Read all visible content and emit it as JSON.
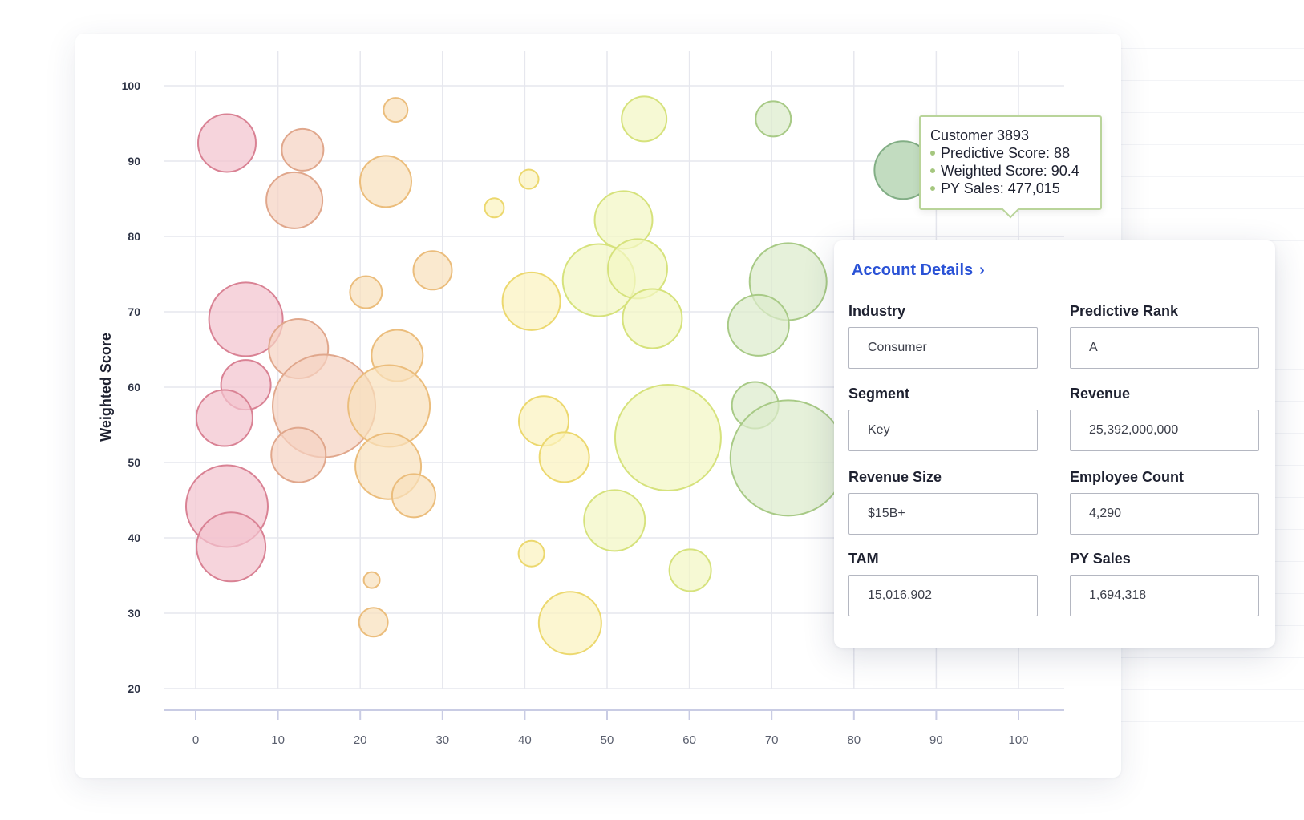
{
  "chart_data": {
    "type": "scatter",
    "ylabel": "Weighted Score",
    "xlabel": "",
    "xlim": [
      0,
      100
    ],
    "ylim": [
      20,
      100
    ],
    "x_ticks": [
      0,
      10,
      20,
      30,
      40,
      50,
      60,
      70,
      80,
      90,
      100
    ],
    "y_ticks": [
      20,
      30,
      40,
      50,
      60,
      70,
      80,
      90,
      100
    ],
    "grid": true,
    "points": [
      {
        "x": 3.8,
        "y": 92.4,
        "size": 36,
        "color": "red"
      },
      {
        "x": 6.1,
        "y": 69,
        "size": 46,
        "color": "red"
      },
      {
        "x": 6.1,
        "y": 60.3,
        "size": 31,
        "color": "red"
      },
      {
        "x": 3.5,
        "y": 55.9,
        "size": 35,
        "color": "red"
      },
      {
        "x": 3.8,
        "y": 44.2,
        "size": 51,
        "color": "red"
      },
      {
        "x": 4.3,
        "y": 38.8,
        "size": 43,
        "color": "red"
      },
      {
        "x": 13,
        "y": 91.5,
        "size": 26,
        "color": "salmon"
      },
      {
        "x": 12,
        "y": 84.8,
        "size": 35,
        "color": "salmon"
      },
      {
        "x": 12.5,
        "y": 65.1,
        "size": 37,
        "color": "salmon"
      },
      {
        "x": 15.6,
        "y": 57.5,
        "size": 64,
        "color": "salmon"
      },
      {
        "x": 12.5,
        "y": 51,
        "size": 34,
        "color": "salmon"
      },
      {
        "x": 24.3,
        "y": 96.8,
        "size": 15,
        "color": "orange"
      },
      {
        "x": 23.1,
        "y": 87.3,
        "size": 32,
        "color": "orange"
      },
      {
        "x": 28.8,
        "y": 75.5,
        "size": 24,
        "color": "orange"
      },
      {
        "x": 20.7,
        "y": 72.6,
        "size": 20,
        "color": "orange"
      },
      {
        "x": 24.5,
        "y": 64.2,
        "size": 32,
        "color": "orange"
      },
      {
        "x": 23.5,
        "y": 57.5,
        "size": 51,
        "color": "orange"
      },
      {
        "x": 23.4,
        "y": 49.5,
        "size": 41,
        "color": "orange"
      },
      {
        "x": 26.5,
        "y": 45.6,
        "size": 27,
        "color": "orange"
      },
      {
        "x": 21.4,
        "y": 34.4,
        "size": 10,
        "color": "orange"
      },
      {
        "x": 21.6,
        "y": 28.8,
        "size": 18,
        "color": "orange"
      },
      {
        "x": 36.3,
        "y": 83.8,
        "size": 12,
        "color": "yellow"
      },
      {
        "x": 40.5,
        "y": 87.6,
        "size": 12,
        "color": "yellow"
      },
      {
        "x": 40.8,
        "y": 71.4,
        "size": 36,
        "color": "yellow"
      },
      {
        "x": 42.3,
        "y": 55.5,
        "size": 31,
        "color": "yellow"
      },
      {
        "x": 44.8,
        "y": 50.7,
        "size": 31,
        "color": "yellow"
      },
      {
        "x": 40.8,
        "y": 37.9,
        "size": 16,
        "color": "yellow"
      },
      {
        "x": 45.5,
        "y": 28.7,
        "size": 39,
        "color": "yellow"
      },
      {
        "x": 54.5,
        "y": 95.6,
        "size": 28,
        "color": "lime"
      },
      {
        "x": 52,
        "y": 82.2,
        "size": 36,
        "color": "lime"
      },
      {
        "x": 49,
        "y": 74.2,
        "size": 45,
        "color": "lime"
      },
      {
        "x": 53.7,
        "y": 75.7,
        "size": 37,
        "color": "lime"
      },
      {
        "x": 55.5,
        "y": 69.1,
        "size": 37,
        "color": "lime"
      },
      {
        "x": 57.4,
        "y": 53.3,
        "size": 66,
        "color": "lime"
      },
      {
        "x": 50.9,
        "y": 42.3,
        "size": 38,
        "color": "lime"
      },
      {
        "x": 60.1,
        "y": 35.7,
        "size": 26,
        "color": "lime"
      },
      {
        "x": 70.2,
        "y": 95.6,
        "size": 22,
        "color": "green"
      },
      {
        "x": 72,
        "y": 74,
        "size": 48,
        "color": "green"
      },
      {
        "x": 68.4,
        "y": 68.2,
        "size": 38,
        "color": "green"
      },
      {
        "x": 68,
        "y": 57.6,
        "size": 29,
        "color": "green"
      },
      {
        "x": 72,
        "y": 50.6,
        "size": 72,
        "color": "green"
      },
      {
        "x": 86,
        "y": 88.8,
        "size": 36,
        "color": "darkgreen",
        "highlighted": true
      }
    ]
  },
  "tooltip": {
    "title": "Customer 3893",
    "predictive_score": "Predictive Score: 88",
    "weighted_score": "Weighted Score: 90.4",
    "py_sales": "PY Sales: 477,015"
  },
  "account_details": {
    "link_label": "Account Details",
    "fields": [
      {
        "label": "Industry",
        "value": "Consumer"
      },
      {
        "label": "Predictive Rank",
        "value": "A"
      },
      {
        "label": "Segment",
        "value": "Key"
      },
      {
        "label": "Revenue",
        "value": "25,392,000,000"
      },
      {
        "label": "Revenue Size",
        "value": "$15B+"
      },
      {
        "label": "Employee Count",
        "value": "4,290"
      },
      {
        "label": "TAM",
        "value": "15,016,902"
      },
      {
        "label": "PY Sales",
        "value": "1,694,318"
      }
    ]
  },
  "colors": {
    "red": {
      "fill": "#f2c4cf",
      "stroke": "#d98294"
    },
    "salmon": {
      "fill": "#f5d3c2",
      "stroke": "#e0a78c"
    },
    "orange": {
      "fill": "#f8e0bc",
      "stroke": "#ebbd7c"
    },
    "yellow": {
      "fill": "#fbf3bf",
      "stroke": "#ecd86e"
    },
    "lime": {
      "fill": "#f3f6c4",
      "stroke": "#d6e27c"
    },
    "green": {
      "fill": "#dcebcc",
      "stroke": "#a8ca86"
    },
    "darkgreen": {
      "fill": "#c2dcc0",
      "stroke": "#82ae85"
    },
    "grid": "#e6e7ee",
    "axis": "#c9cce4",
    "link": "#2a52d6"
  }
}
